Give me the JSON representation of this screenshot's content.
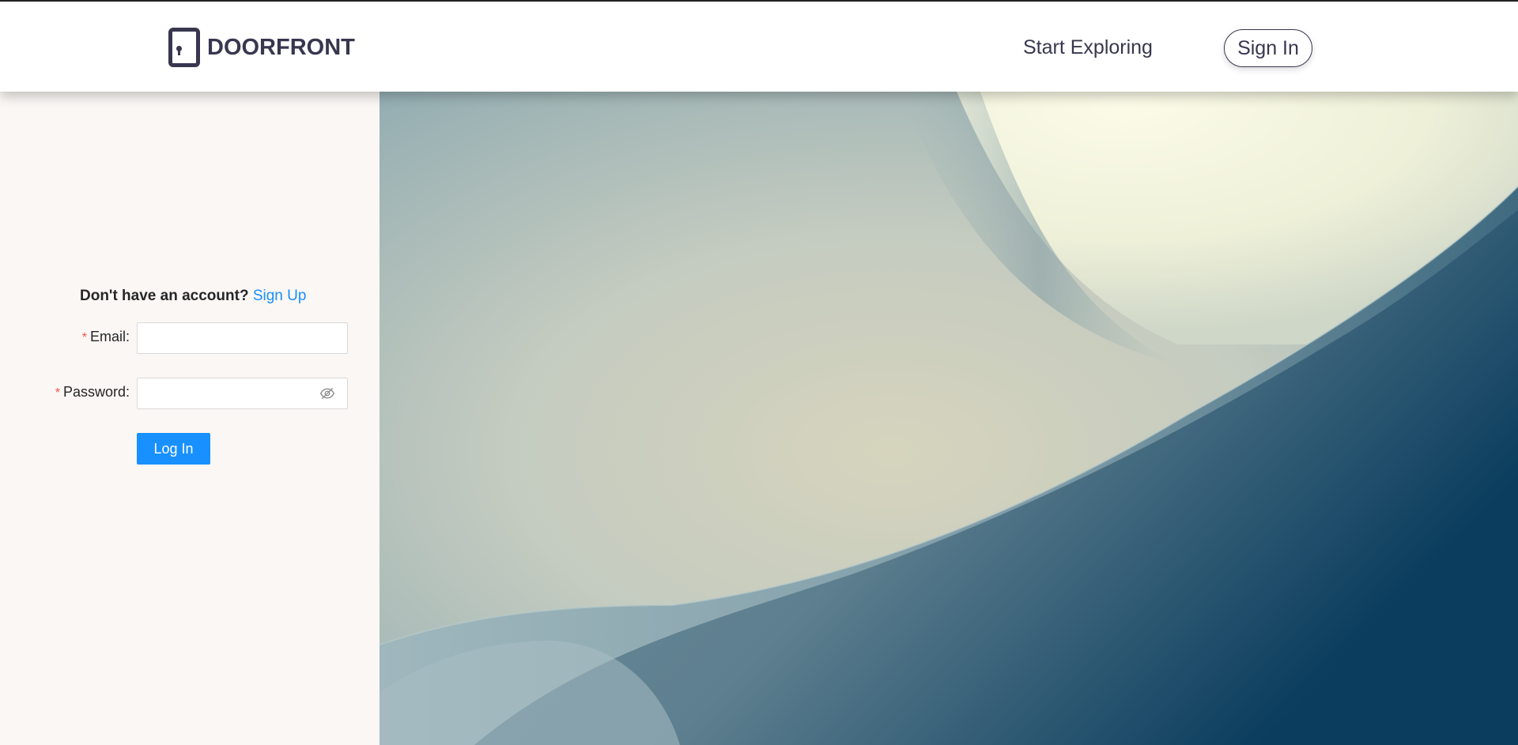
{
  "header": {
    "logo_text": "DOORFRONT",
    "nav_explore": "Start Exploring",
    "nav_signin": "Sign In"
  },
  "login": {
    "no_account_text": "Don't have an account?",
    "signup_link": "Sign Up",
    "email_label": "Email",
    "email_required_mark": "*",
    "email_value": "",
    "password_label": "Password",
    "password_required_mark": "*",
    "password_value": "",
    "submit_label": "Log In",
    "label_colon": ":"
  },
  "colors": {
    "brand_dark": "#38374f",
    "primary_blue": "#1890ff",
    "required_red": "#ff4d4f",
    "panel_bg": "#fbf7f4"
  },
  "icons": {
    "logo": "door-icon",
    "password_toggle": "eye-invisible-icon"
  }
}
